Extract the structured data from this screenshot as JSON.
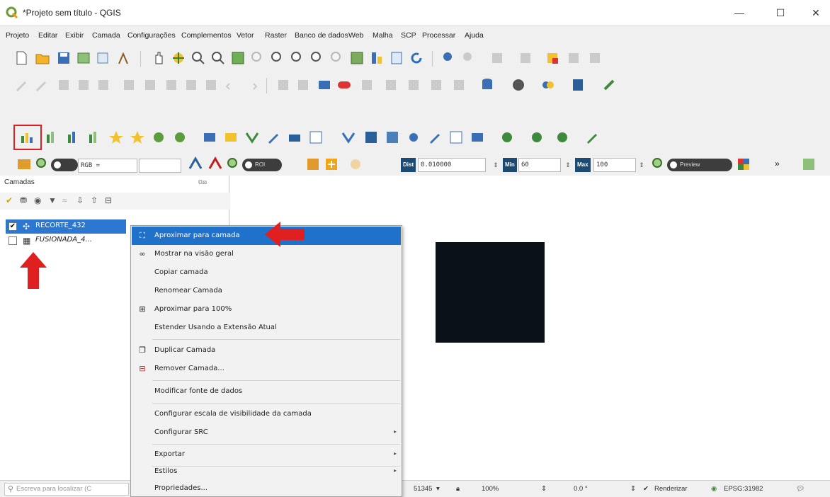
{
  "window": {
    "title": "*Projeto sem título - QGIS",
    "minimize": "—",
    "maximize": "☐",
    "close": "✕"
  },
  "menubar": [
    "Projeto",
    "Editar",
    "Exibir",
    "Camada",
    "Configurações",
    "Complementos",
    "Vetor",
    "Raster",
    "Banco de dados",
    "Web",
    "Malha",
    "SCP",
    "Processar",
    "Ajuda"
  ],
  "scp_toolbar": {
    "rgb_label": "RGB =",
    "roi_label": "ROI",
    "dist_label": "Dist",
    "dist_value": "0.010000",
    "min_label": "Min",
    "min_value": "60",
    "max_label": "Max",
    "max_value": "100",
    "preview_label": "Preview",
    "more": "»"
  },
  "layers_panel": {
    "title": "Camadas",
    "layers": [
      {
        "name": "RECORTE_432",
        "checked": true,
        "selected": true
      },
      {
        "name": "FUSIONADA_4...",
        "checked": false,
        "selected": false
      }
    ]
  },
  "context_menu": {
    "items": [
      {
        "label": "Aproximar para camada",
        "icon": "zoom-to-layer-icon",
        "glyph": "⛶",
        "active": true,
        "submenu": false
      },
      {
        "label": "Mostrar na visão geral",
        "icon": "overview-icon",
        "glyph": "∞",
        "active": false,
        "submenu": false
      },
      {
        "label": "Copiar camada",
        "icon": "",
        "glyph": "",
        "active": false,
        "submenu": false
      },
      {
        "label": "Renomear Camada",
        "icon": "",
        "glyph": "",
        "active": false,
        "submenu": false
      },
      {
        "label": "Aproximar para 100%",
        "icon": "zoom-native-icon",
        "glyph": "⊞",
        "active": false,
        "submenu": false
      },
      {
        "label": "Estender Usando a Extensão Atual",
        "icon": "",
        "glyph": "",
        "active": false,
        "submenu": false
      },
      {
        "label": "Duplicar Camada",
        "icon": "duplicate-layer-icon",
        "glyph": "❐",
        "active": false,
        "submenu": false
      },
      {
        "label": "Remover Camada...",
        "icon": "remove-layer-icon",
        "glyph": "⊟",
        "active": false,
        "submenu": false
      },
      {
        "label": "Modificar fonte de dados",
        "icon": "",
        "glyph": "",
        "active": false,
        "submenu": false
      },
      {
        "label": "Configurar escala de visibilidade da camada",
        "icon": "",
        "glyph": "",
        "active": false,
        "submenu": false
      },
      {
        "label": "Configurar SRC",
        "icon": "",
        "glyph": "",
        "active": false,
        "submenu": true
      },
      {
        "label": "Exportar",
        "icon": "",
        "glyph": "",
        "active": false,
        "submenu": true
      },
      {
        "label": "Estilos",
        "icon": "",
        "glyph": "",
        "active": false,
        "submenu": true
      },
      {
        "label": "Propriedades...",
        "icon": "",
        "glyph": "",
        "active": false,
        "submenu": false
      }
    ]
  },
  "statusbar": {
    "search_placeholder": "Escreva para localizar (C",
    "scale": "51345",
    "magnifier": "100%",
    "rotation": "0.0 °",
    "render_label": "Renderizar",
    "crs": "EPSG:31982"
  }
}
